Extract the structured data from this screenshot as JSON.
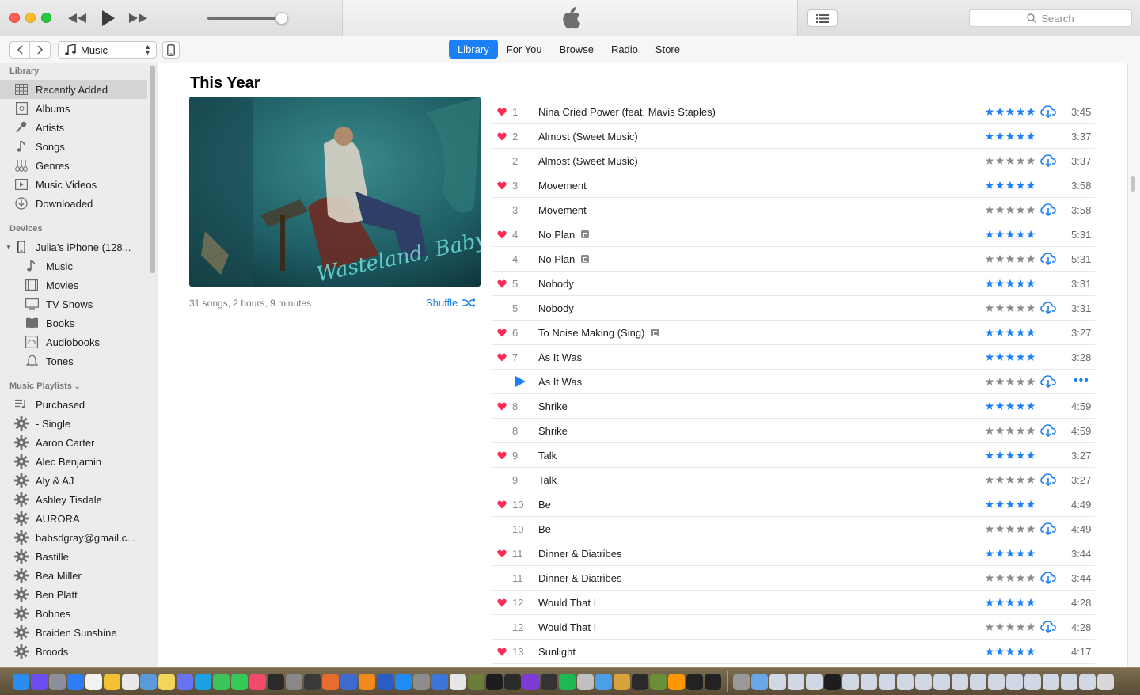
{
  "window": {
    "app": "Music"
  },
  "toolbar": {
    "search_placeholder": "Search",
    "media_kind": "Music"
  },
  "tabs": [
    {
      "label": "Library",
      "active": true
    },
    {
      "label": "For You",
      "active": false
    },
    {
      "label": "Browse",
      "active": false
    },
    {
      "label": "Radio",
      "active": false
    },
    {
      "label": "Store",
      "active": false
    }
  ],
  "sidebar": {
    "library_heading": "Library",
    "library": [
      {
        "label": "Recently Added",
        "icon": "grid-icon",
        "selected": true
      },
      {
        "label": "Albums",
        "icon": "album-icon"
      },
      {
        "label": "Artists",
        "icon": "microphone-icon"
      },
      {
        "label": "Songs",
        "icon": "note-icon"
      },
      {
        "label": "Genres",
        "icon": "guitars-icon"
      },
      {
        "label": "Music Videos",
        "icon": "video-icon"
      },
      {
        "label": "Downloaded",
        "icon": "download-icon"
      }
    ],
    "devices_heading": "Devices",
    "device": {
      "label": "Julia’s iPhone (128...",
      "icon": "phone-icon"
    },
    "device_items": [
      {
        "label": "Music",
        "icon": "note-icon"
      },
      {
        "label": "Movies",
        "icon": "film-icon"
      },
      {
        "label": "TV Shows",
        "icon": "tv-icon"
      },
      {
        "label": "Books",
        "icon": "book-icon"
      },
      {
        "label": "Audiobooks",
        "icon": "audiobook-icon"
      },
      {
        "label": "Tones",
        "icon": "bell-icon"
      }
    ],
    "playlists_heading": "Music Playlists",
    "playlists": [
      {
        "label": "Purchased",
        "icon": "playlist-icon"
      },
      {
        "label": "- Single",
        "icon": "gear-icon"
      },
      {
        "label": "Aaron Carter",
        "icon": "gear-icon"
      },
      {
        "label": "Alec Benjamin",
        "icon": "gear-icon"
      },
      {
        "label": "Aly & AJ",
        "icon": "gear-icon"
      },
      {
        "label": "Ashley Tisdale",
        "icon": "gear-icon"
      },
      {
        "label": "AURORA",
        "icon": "gear-icon"
      },
      {
        "label": "babsdgray@gmail.c...",
        "icon": "gear-icon"
      },
      {
        "label": "Bastille",
        "icon": "gear-icon"
      },
      {
        "label": "Bea Miller",
        "icon": "gear-icon"
      },
      {
        "label": "Ben Platt",
        "icon": "gear-icon"
      },
      {
        "label": "Bohnes",
        "icon": "gear-icon"
      },
      {
        "label": "Braiden Sunshine",
        "icon": "gear-icon"
      },
      {
        "label": "Broods",
        "icon": "gear-icon"
      }
    ]
  },
  "main": {
    "section_title": "This Year",
    "album_info": "31 songs, 2 hours, 9 minutes",
    "shuffle_label": "Shuffle",
    "album_art_text": "Wasteland, Baby!",
    "tracks": [
      {
        "num": "1",
        "title": "Nina Cried Power (feat. Mavis Staples)",
        "loved": true,
        "rated": true,
        "cloud": true,
        "explicit": false,
        "duration": "3:45"
      },
      {
        "num": "2",
        "title": "Almost (Sweet Music)",
        "loved": true,
        "rated": true,
        "cloud": false,
        "explicit": false,
        "duration": "3:37"
      },
      {
        "num": "2",
        "title": "Almost (Sweet Music)",
        "loved": false,
        "rated": false,
        "cloud": true,
        "explicit": false,
        "duration": "3:37"
      },
      {
        "num": "3",
        "title": "Movement",
        "loved": true,
        "rated": true,
        "cloud": false,
        "explicit": false,
        "duration": "3:58"
      },
      {
        "num": "3",
        "title": "Movement",
        "loved": false,
        "rated": false,
        "cloud": true,
        "explicit": false,
        "duration": "3:58"
      },
      {
        "num": "4",
        "title": "No Plan",
        "loved": true,
        "rated": true,
        "cloud": false,
        "explicit": true,
        "duration": "5:31"
      },
      {
        "num": "4",
        "title": "No Plan",
        "loved": false,
        "rated": false,
        "cloud": true,
        "explicit": true,
        "duration": "5:31"
      },
      {
        "num": "5",
        "title": "Nobody",
        "loved": true,
        "rated": true,
        "cloud": false,
        "explicit": false,
        "duration": "3:31"
      },
      {
        "num": "5",
        "title": "Nobody",
        "loved": false,
        "rated": false,
        "cloud": true,
        "explicit": false,
        "duration": "3:31"
      },
      {
        "num": "6",
        "title": "To Noise Making (Sing)",
        "loved": true,
        "rated": true,
        "cloud": false,
        "explicit": true,
        "duration": "3:27"
      },
      {
        "num": "7",
        "title": "As It Was",
        "loved": true,
        "rated": true,
        "cloud": false,
        "explicit": false,
        "duration": "3:28"
      },
      {
        "num": "",
        "title": "As It Was",
        "loved": false,
        "rated": false,
        "cloud": true,
        "explicit": false,
        "duration": "",
        "playing": true,
        "more": true
      },
      {
        "num": "8",
        "title": "Shrike",
        "loved": true,
        "rated": true,
        "cloud": false,
        "explicit": false,
        "duration": "4:59"
      },
      {
        "num": "8",
        "title": "Shrike",
        "loved": false,
        "rated": false,
        "cloud": true,
        "explicit": false,
        "duration": "4:59"
      },
      {
        "num": "9",
        "title": "Talk",
        "loved": true,
        "rated": true,
        "cloud": false,
        "explicit": false,
        "duration": "3:27"
      },
      {
        "num": "9",
        "title": "Talk",
        "loved": false,
        "rated": false,
        "cloud": true,
        "explicit": false,
        "duration": "3:27"
      },
      {
        "num": "10",
        "title": "Be",
        "loved": true,
        "rated": true,
        "cloud": false,
        "explicit": false,
        "duration": "4:49"
      },
      {
        "num": "10",
        "title": "Be",
        "loved": false,
        "rated": false,
        "cloud": true,
        "explicit": false,
        "duration": "4:49"
      },
      {
        "num": "11",
        "title": "Dinner & Diatribes",
        "loved": true,
        "rated": true,
        "cloud": false,
        "explicit": false,
        "duration": "3:44"
      },
      {
        "num": "11",
        "title": "Dinner & Diatribes",
        "loved": false,
        "rated": false,
        "cloud": true,
        "explicit": false,
        "duration": "3:44"
      },
      {
        "num": "12",
        "title": "Would That I",
        "loved": true,
        "rated": true,
        "cloud": false,
        "explicit": false,
        "duration": "4:28"
      },
      {
        "num": "12",
        "title": "Would That I",
        "loved": false,
        "rated": false,
        "cloud": true,
        "explicit": false,
        "duration": "4:28"
      },
      {
        "num": "13",
        "title": "Sunlight",
        "loved": true,
        "rated": true,
        "cloud": false,
        "explicit": false,
        "duration": "4:17"
      }
    ]
  },
  "colors": {
    "accent": "#1b7ff5",
    "heart": "#ff2d55",
    "star_rated": "#1b7ff5",
    "star_unrated": "#8a8a8a",
    "sidebar_bg": "#ececec"
  },
  "dock": {
    "apps": [
      "finder-icon",
      "siri-icon",
      "launchpad-icon",
      "safari-icon",
      "calendar-icon",
      "chrome-icon",
      "textedit-icon",
      "preview-icon",
      "notes-icon",
      "discord-icon",
      "skype-icon",
      "messages-icon",
      "facetime-icon",
      "itunes-icon",
      "photos-icon",
      "utility-icon",
      "script-icon",
      "firefox-icon",
      "quicktime-icon",
      "vlc-icon",
      "word-icon",
      "appstore-icon",
      "preferences-icon",
      "browser-icon",
      "mkv-icon",
      "game-icon",
      "terminal-icon",
      "terminal2-icon",
      "imovie-icon",
      "steam-icon",
      "spotify-icon",
      "photobooth-icon",
      "maps-icon",
      "utility2-icon",
      "trash-dev-icon",
      "minecraft-icon",
      "sublime-icon",
      "terminal3-icon",
      "terminal4-icon",
      "downloads-icon",
      "folder-icon",
      "window-icon",
      "window2-icon",
      "window3-icon",
      "window4-icon",
      "window5-icon",
      "window6-icon",
      "window7-icon",
      "window8-icon",
      "window9-icon",
      "window10-icon",
      "window11-icon",
      "window12-icon",
      "window13-icon",
      "window14-icon",
      "window15-icon",
      "window16-icon",
      "window17-icon",
      "window18-icon",
      "trash-icon"
    ]
  }
}
